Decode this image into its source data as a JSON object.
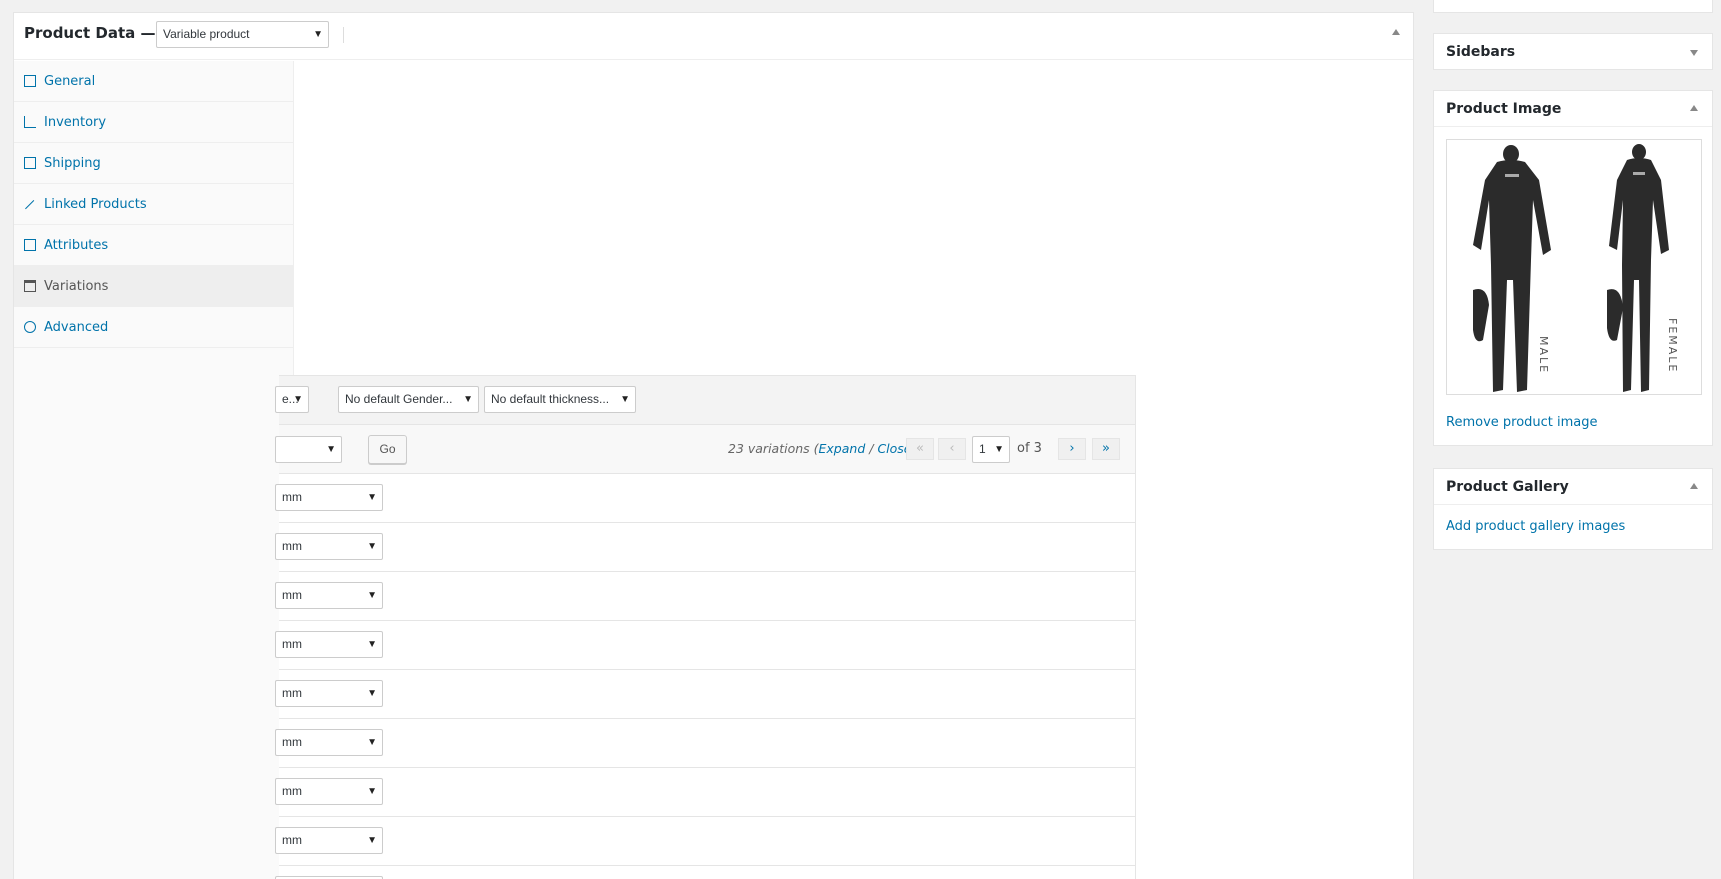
{
  "product_data": {
    "title": "Product Data —",
    "type_select_value": "Variable product",
    "tabs": [
      {
        "label": "General",
        "icon": "general-icon"
      },
      {
        "label": "Inventory",
        "icon": "inventory-icon"
      },
      {
        "label": "Shipping",
        "icon": "shipping-icon"
      },
      {
        "label": "Linked Products",
        "icon": "link-icon"
      },
      {
        "label": "Attributes",
        "icon": "attributes-icon"
      },
      {
        "label": "Variations",
        "icon": "variations-icon",
        "active": true
      },
      {
        "label": "Advanced",
        "icon": "gear-icon"
      }
    ]
  },
  "variations": {
    "default_selects": [
      "e...",
      "No default Gender...",
      "No default thickness..."
    ],
    "go_label": "Go",
    "count_text": "23 variations (",
    "expand_label": "Expand",
    "sep": " / ",
    "close_label": "Close",
    "count_end": ")",
    "pagination": {
      "first": "«",
      "prev": "‹",
      "current_page": "1",
      "of_text": "of 3",
      "next": "›",
      "last": "»"
    },
    "rows": [
      {
        "value": "mm"
      },
      {
        "value": "mm"
      },
      {
        "value": "mm"
      },
      {
        "value": "mm"
      },
      {
        "value": "mm"
      },
      {
        "value": "mm"
      },
      {
        "value": "mm"
      },
      {
        "value": "mm"
      }
    ]
  },
  "sidebar": {
    "sidebars_title": "Sidebars",
    "product_image_title": "Product Image",
    "image_labels": {
      "left": "MALE",
      "right": "FEMALE"
    },
    "remove_image_label": "Remove product image",
    "gallery_title": "Product Gallery",
    "add_gallery_label": "Add product gallery images"
  },
  "colors": {
    "link": "#0073aa",
    "panel_bg": "#f1f1f1"
  }
}
